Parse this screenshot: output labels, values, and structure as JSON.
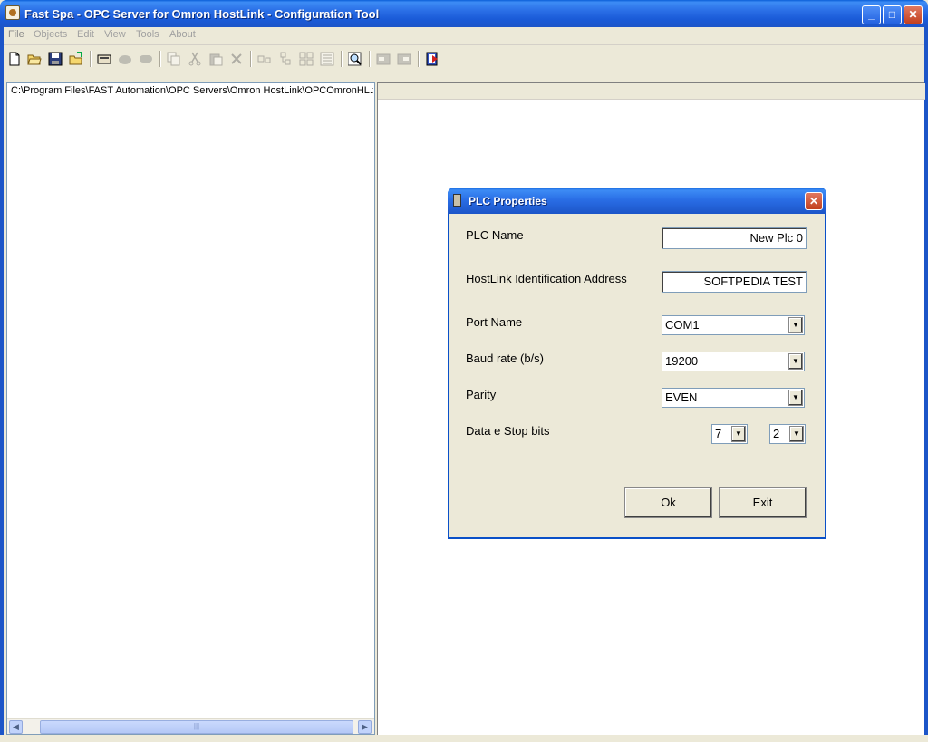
{
  "window": {
    "title": "Fast Spa - OPC Server for Omron HostLink - Configuration Tool",
    "minimize_glyph": "_",
    "maximize_glyph": "□",
    "close_glyph": "✕"
  },
  "menu": {
    "items": [
      "File",
      "Objects",
      "Edit",
      "View",
      "Tools",
      "About"
    ]
  },
  "toolbar": {
    "icons": [
      "new-file-icon",
      "open-folder-icon",
      "save-icon",
      "open-project-icon",
      "add-device-icon",
      "add-group-icon",
      "add-item-icon",
      "copy-icon",
      "cut-icon",
      "paste-icon",
      "delete-icon",
      "align-left-icon",
      "align-tree-icon",
      "grid-icon",
      "list-icon",
      "search-icon",
      "export-icon",
      "import-icon",
      "help-icon"
    ]
  },
  "left_pane": {
    "path": "C:\\Program Files\\FAST Automation\\OPC Servers\\Omron HostLink\\OPCOmronHL.xm",
    "scroll_left": "◀",
    "scroll_right": "▶",
    "scroll_grip": "|||"
  },
  "dialog": {
    "title": "PLC Properties",
    "close_glyph": "✕",
    "plc_name_label": "PLC Name",
    "plc_name_value": "New Plc 0",
    "hostlink_label": "HostLink Identification Address",
    "hostlink_value": "SOFTPEDIA TEST",
    "port_label": "Port Name",
    "port_value": "COM1",
    "baud_label": "Baud rate (b/s)",
    "baud_value": "19200",
    "parity_label": "Parity",
    "parity_value": "EVEN",
    "databits_label": "Data e Stop bits",
    "data_bits_value": "7",
    "stop_bits_value": "2",
    "ok_label": "Ok",
    "exit_label": "Exit",
    "dropdown_glyph": "▼"
  }
}
